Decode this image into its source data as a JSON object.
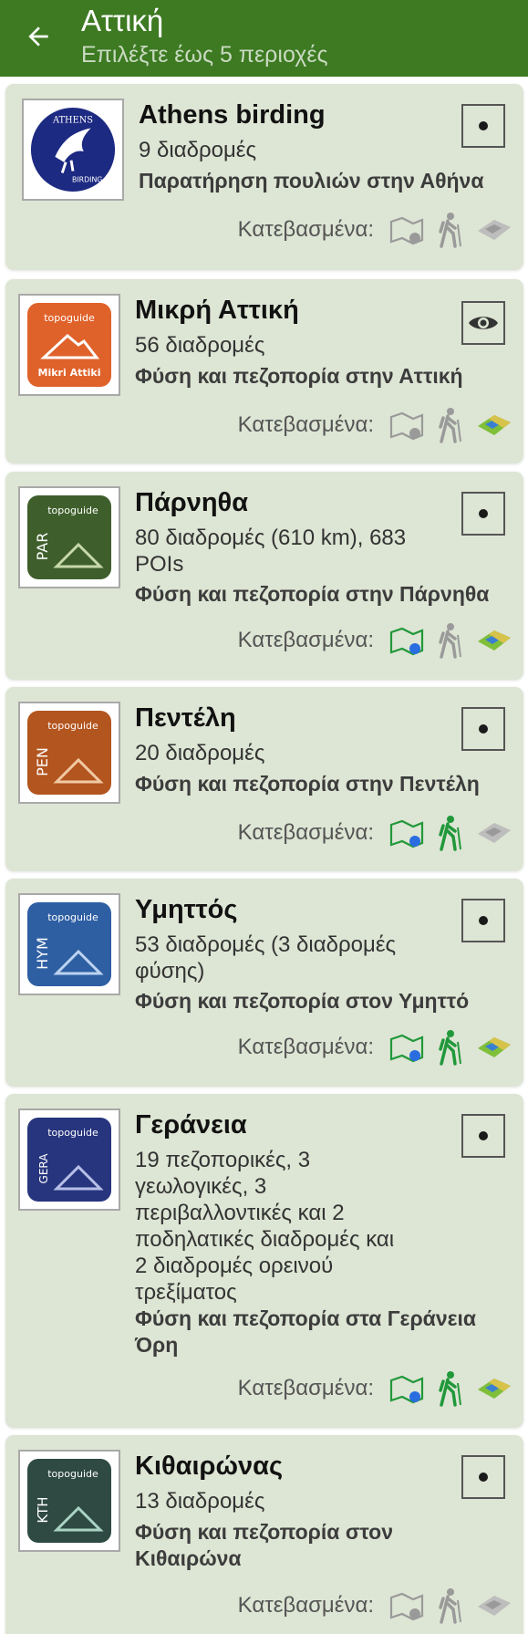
{
  "header": {
    "title": "Αττική",
    "subtitle": "Επιλέξτε έως 5 περιοχές",
    "back_icon": "arrow-left-icon"
  },
  "colors": {
    "appbar": "#3d7a22",
    "card": "#dde5d4",
    "download_active_green": "#21983a",
    "download_active_blue": "#2a6de0",
    "download_inactive": "#9a9a9a"
  },
  "downloaded_label": "Κατεβασμένα:",
  "regions": [
    {
      "name": "Athens birding",
      "routes": "9 διαδρομές",
      "description": "Παρατήρηση πουλιών στην Αθήνα",
      "logo": {
        "type": "birding",
        "text_top": "ATHENS",
        "text_bottom": "BIRDING"
      },
      "action_icon": "select-dot-icon",
      "downloads": {
        "guide": false,
        "hiking": false,
        "map": false
      }
    },
    {
      "name": "Μικρή Αττική",
      "routes": "56 διαδρομές",
      "description": "Φύση και πεζοπορία στην Αττική",
      "logo": {
        "type": "topoguide",
        "code": "",
        "caption": "Mikri Attiki",
        "brand": "topoguide",
        "color": "#e0622b"
      },
      "action_icon": "eye-icon",
      "downloads": {
        "guide": false,
        "hiking": false,
        "map": true
      }
    },
    {
      "name": "Πάρνηθα",
      "routes": "80 διαδρομές (610 km), 683 POIs",
      "description": "Φύση και πεζοπορία στην Πάρνηθα",
      "logo": {
        "type": "topoguide",
        "code": "PAR",
        "brand": "topoguide",
        "color": "#3e5f2c"
      },
      "action_icon": "select-dot-icon",
      "downloads": {
        "guide": true,
        "hiking": false,
        "map": true
      }
    },
    {
      "name": "Πεντέλη",
      "routes": "20 διαδρομές",
      "description": "Φύση και πεζοπορία στην Πεντέλη",
      "logo": {
        "type": "topoguide",
        "code": "PEN",
        "brand": "topoguide",
        "color": "#b3551f"
      },
      "action_icon": "select-dot-icon",
      "downloads": {
        "guide": true,
        "hiking": true,
        "map": false
      }
    },
    {
      "name": "Υμηττός",
      "routes": "53 διαδρομές (3 διαδρομές φύσης)",
      "description": "Φύση και πεζοπορία στον Υμηττό",
      "logo": {
        "type": "topoguide",
        "code": "HYM",
        "brand": "topoguide",
        "color": "#2f5fa3"
      },
      "action_icon": "select-dot-icon",
      "downloads": {
        "guide": true,
        "hiking": true,
        "map": true
      }
    },
    {
      "name": "Γεράνεια",
      "routes": "19 πεζοπορικές, 3 γεωλογικές, 3 περιβαλλοντικές και 2 ποδηλατικές διαδρομές και 2 διαδρομές ορεινού τρεξίματος",
      "description": "Φύση και πεζοπορία στα Γεράνεια Όρη",
      "logo": {
        "type": "topoguide",
        "code": "GERA",
        "brand": "topoguide",
        "color": "#27357e"
      },
      "action_icon": "select-dot-icon",
      "downloads": {
        "guide": true,
        "hiking": true,
        "map": true
      }
    },
    {
      "name": "Κιθαιρώνας",
      "routes": "13 διαδρομές",
      "description": "Φύση και πεζοπορία στον Κιθαιρώνα",
      "logo": {
        "type": "topoguide",
        "code": "KTH",
        "brand": "topoguide",
        "color": "#2e4a43"
      },
      "action_icon": "select-dot-icon",
      "downloads": {
        "guide": false,
        "hiking": false,
        "map": false
      }
    }
  ]
}
